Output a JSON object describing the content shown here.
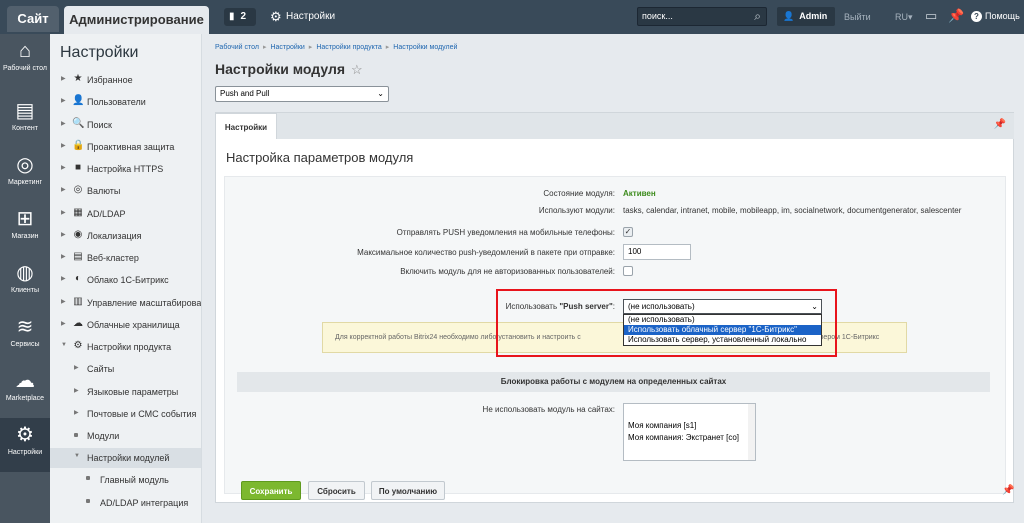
{
  "topbar": {
    "tab_site": "Сайт",
    "tab_admin": "Администрирование",
    "notif_count": "2",
    "settings": "Настройки",
    "search_placeholder": "поиск...",
    "user": "Admin",
    "logout": "Выйти",
    "lang": "RU",
    "help": "Помощь"
  },
  "leftbar": [
    {
      "label": "Рабочий стол",
      "icon": "home-icon"
    },
    {
      "label": "Контент",
      "icon": "document-icon"
    },
    {
      "label": "Маркетинг",
      "icon": "target-icon"
    },
    {
      "label": "Магазин",
      "icon": "basket-icon"
    },
    {
      "label": "Клиенты",
      "icon": "clients-icon"
    },
    {
      "label": "Сервисы",
      "icon": "layers-icon"
    },
    {
      "label": "Marketplace",
      "icon": "cloud-icon"
    },
    {
      "label": "Настройки",
      "icon": "gear-icon"
    }
  ],
  "menu": {
    "title": "Настройки",
    "items": [
      {
        "label": "Избранное",
        "icon": "★"
      },
      {
        "label": "Пользователи",
        "icon": "👤"
      },
      {
        "label": "Поиск",
        "icon": "🔍"
      },
      {
        "label": "Проактивная защита",
        "icon": "🔒"
      },
      {
        "label": "Настройка HTTPS",
        "icon": "■"
      },
      {
        "label": "Валюты",
        "icon": "◎"
      },
      {
        "label": "AD/LDAP",
        "icon": "▦"
      },
      {
        "label": "Локализация",
        "icon": "◉"
      },
      {
        "label": "Веб-кластер",
        "icon": "▤"
      },
      {
        "label": "Облако 1С-Битрикс",
        "icon": "◐"
      },
      {
        "label": "Управление масштабированием",
        "icon": "▥"
      },
      {
        "label": "Облачные хранилища",
        "icon": "☁"
      },
      {
        "label": "Настройки продукта",
        "icon": "⚙"
      },
      {
        "label": "Сайты",
        "icon": ""
      },
      {
        "label": "Языковые параметры",
        "icon": ""
      },
      {
        "label": "Почтовые и СМС события",
        "icon": ""
      },
      {
        "label": "Модули",
        "icon": ""
      },
      {
        "label": "Настройки модулей",
        "icon": ""
      },
      {
        "label": "Главный модуль",
        "icon": ""
      },
      {
        "label": "AD/LDAP интеграция",
        "icon": ""
      }
    ]
  },
  "breadcrumbs": [
    "Рабочий стол",
    "Настройки",
    "Настройки продукта",
    "Настройки модулей"
  ],
  "page_title": "Настройки модуля",
  "module_select": "Push and Pull",
  "tab_label": "Настройки",
  "panel_title": "Настройка параметров модуля",
  "form": {
    "status_label": "Состояние модуля:",
    "status_value": "Активен",
    "used_label": "Используют модули:",
    "used_value": "tasks, calendar, intranet, mobile, mobileapp, im, socialnetwork, documentgenerator, salescenter",
    "push_mobile_label": "Отправлять PUSH уведомления на мобильные телефоны:",
    "max_push_label": "Максимальное количество push-уведомлений в пакете при отправке:",
    "max_push_value": "100",
    "guests_label": "Включить модуль для не авторизованных пользователей:",
    "push_server_label_a": "Использовать ",
    "push_server_label_b": "\"Push server\"",
    "push_server_label_c": ":",
    "push_server_value": "(не использовать)",
    "options": [
      "(не использовать)",
      "Использовать облачный сервер \"1С-Битрикс\"",
      "Использовать сервер, установленный локально"
    ],
    "warning_a": "Для корректной работы Bitrix24 необходимо либо установить и настроить с",
    "warning_b": "ервером 1С-Битрикс",
    "section_title": "Блокировка работы с модулем на определенных сайтах",
    "no_use_label": "Не использовать модуль на сайтах:",
    "sites": [
      "Моя компания [s1]",
      "Моя компания: Экстранет [co]"
    ]
  },
  "buttons": {
    "save": "Сохранить",
    "reset": "Сбросить",
    "default": "По умолчанию"
  },
  "colors": {
    "topbar": "#394a59",
    "accent_green": "#7cb82f",
    "highlight_red": "#e8141c",
    "selected_option": "#1b63c7"
  }
}
